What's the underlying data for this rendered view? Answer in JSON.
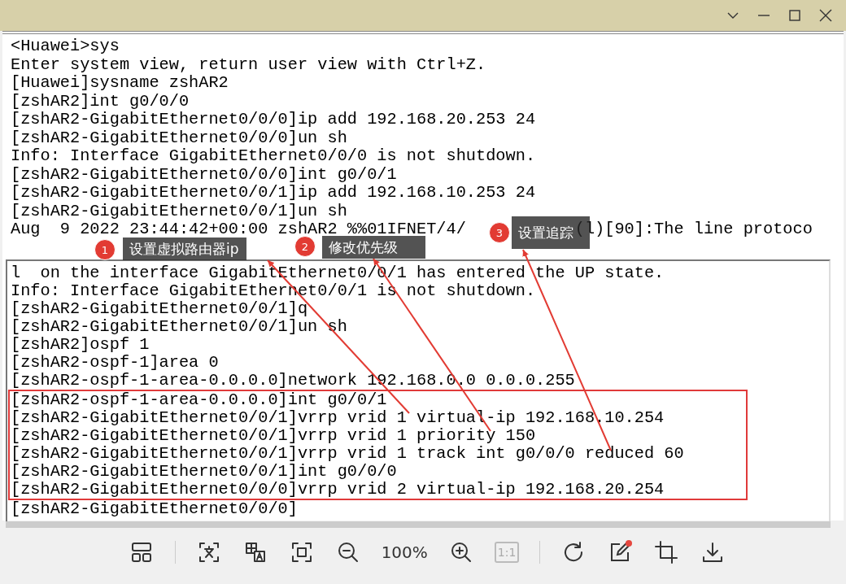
{
  "terminal": {
    "top_pane": {
      "lines": [
        {
          "text": "<Huawei>sys"
        },
        {
          "text": "Enter system view, return user view with Ctrl+Z."
        },
        {
          "text": "[Huawei]sysname zshAR2"
        },
        {
          "text": "[zshAR2]int g0/0/0"
        },
        {
          "text": "[zshAR2-GigabitEthernet0/0/0]ip add 192.168.20.253 24"
        },
        {
          "text": "[zshAR2-GigabitEthernet0/0/0]un sh"
        },
        {
          "text": "Info: Interface GigabitEthernet0/0/0 is not shutdown."
        },
        {
          "text": "[zshAR2-GigabitEthernet0/0/0]int g0/0/1"
        },
        {
          "text": "[zshAR2-GigabitEthernet0/0/1]ip add 192.168.10.253 24"
        },
        {
          "text": "[zshAR2-GigabitEthernet0/0/1]un sh"
        },
        {
          "text": "Aug  9 2022 23:44:42+00:00 zshAR2 %%01IFNET/4/",
          "text_after_cover": "(l)[90]:The line protoco"
        }
      ]
    },
    "bottom_pane": {
      "lines": [
        {
          "text": "l  on the interface GigabitEthernet0/0/1 has entered the UP state.",
          "boxed": false
        },
        {
          "text": "Info: Interface GigabitEthernet0/0/1 is not shutdown.",
          "boxed": false
        },
        {
          "text": "[zshAR2-GigabitEthernet0/0/1]q",
          "boxed": false
        },
        {
          "text": "[zshAR2-GigabitEthernet0/0/1]un sh",
          "boxed": false
        },
        {
          "text": "[zshAR2]ospf 1",
          "boxed": false
        },
        {
          "text": "[zshAR2-ospf-1]area 0",
          "boxed": false
        },
        {
          "text": "[zshAR2-ospf-1-area-0.0.0.0]network 192.168.0.0 0.0.0.255",
          "boxed": false
        },
        {
          "text": "[zshAR2-ospf-1-area-0.0.0.0]int g0/0/1",
          "boxed": true
        },
        {
          "text": "[zshAR2-GigabitEthernet0/0/1]vrrp vrid 1 virtual-ip 192.168.10.254",
          "boxed": true
        },
        {
          "text": "[zshAR2-GigabitEthernet0/0/1]vrrp vrid 1 priority 150",
          "boxed": true
        },
        {
          "text": "[zshAR2-GigabitEthernet0/0/1]vrrp vrid 1 track int g0/0/0 reduced 60",
          "boxed": true
        },
        {
          "text": "[zshAR2-GigabitEthernet0/0/1]int g0/0/0",
          "boxed": true
        },
        {
          "text": "[zshAR2-GigabitEthernet0/0/0]vrrp vrid 2 virtual-ip 192.168.20.254",
          "boxed": true
        },
        {
          "text": "[zshAR2-GigabitEthernet0/0/0]",
          "boxed": false
        }
      ]
    }
  },
  "annotations": [
    {
      "number": "1",
      "label": "设置虚拟路由器ip"
    },
    {
      "number": "2",
      "label": "修改优先级"
    },
    {
      "number": "3",
      "label": "设置追踪"
    }
  ],
  "toolbar": {
    "zoom_level": "100%",
    "actual_size": {
      "label": "1:1",
      "disabled": true
    }
  }
}
